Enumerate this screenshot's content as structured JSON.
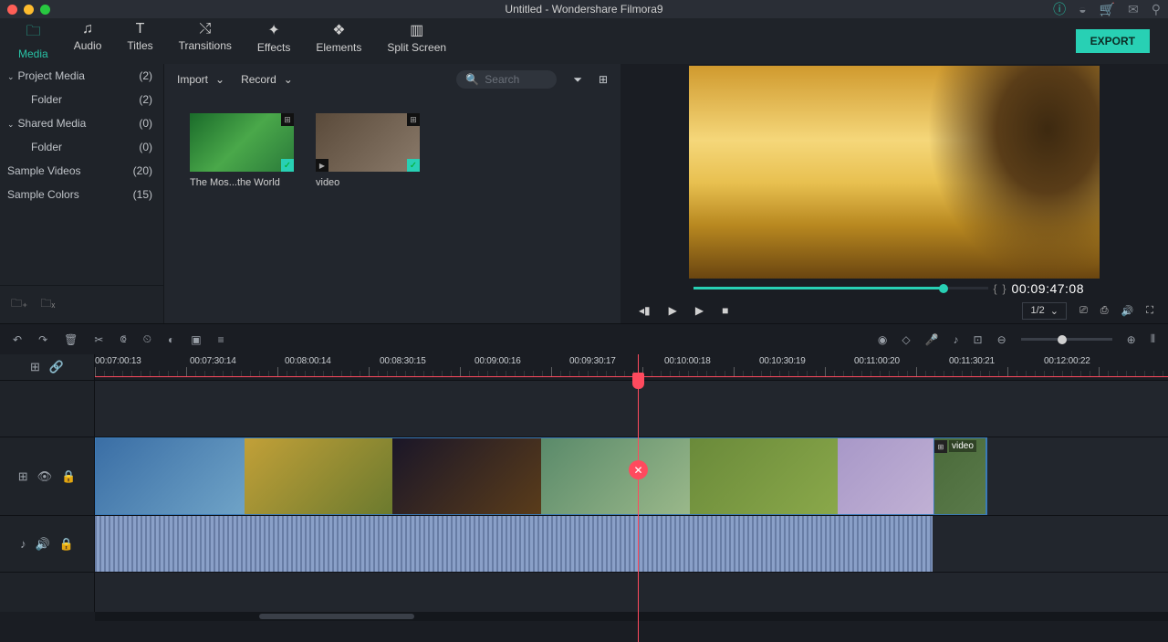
{
  "titlebar": {
    "title": "Untitled - Wondershare Filmora9"
  },
  "tabs": {
    "media": "Media",
    "audio": "Audio",
    "titles": "Titles",
    "transitions": "Transitions",
    "effects": "Effects",
    "elements": "Elements",
    "split": "Split Screen"
  },
  "export_label": "EXPORT",
  "sidebar": {
    "items": [
      {
        "label": "Project Media",
        "count": "(2)",
        "expandable": true
      },
      {
        "label": "Folder",
        "count": "(2)",
        "sub": true
      },
      {
        "label": "Shared Media",
        "count": "(0)",
        "expandable": true
      },
      {
        "label": "Folder",
        "count": "(0)",
        "sub": true
      },
      {
        "label": "Sample Videos",
        "count": "(20)"
      },
      {
        "label": "Sample Colors",
        "count": "(15)"
      }
    ]
  },
  "media_toolbar": {
    "import": "Import",
    "record": "Record",
    "search_placeholder": "Search"
  },
  "media_items": [
    {
      "label": "The Mos...the World"
    },
    {
      "label": "video"
    }
  ],
  "preview": {
    "timecode": "00:09:47:08",
    "ratio": "1/2"
  },
  "ruler_labels": [
    "00:07:00:13",
    "00:07:30:14",
    "00:08:00:14",
    "00:08:30:15",
    "00:09:00:16",
    "00:09:30:17",
    "00:10:00:18",
    "00:10:30:19",
    "00:11:00:20",
    "00:11:30:21",
    "00:12:00:22"
  ],
  "clip2_label": "video"
}
